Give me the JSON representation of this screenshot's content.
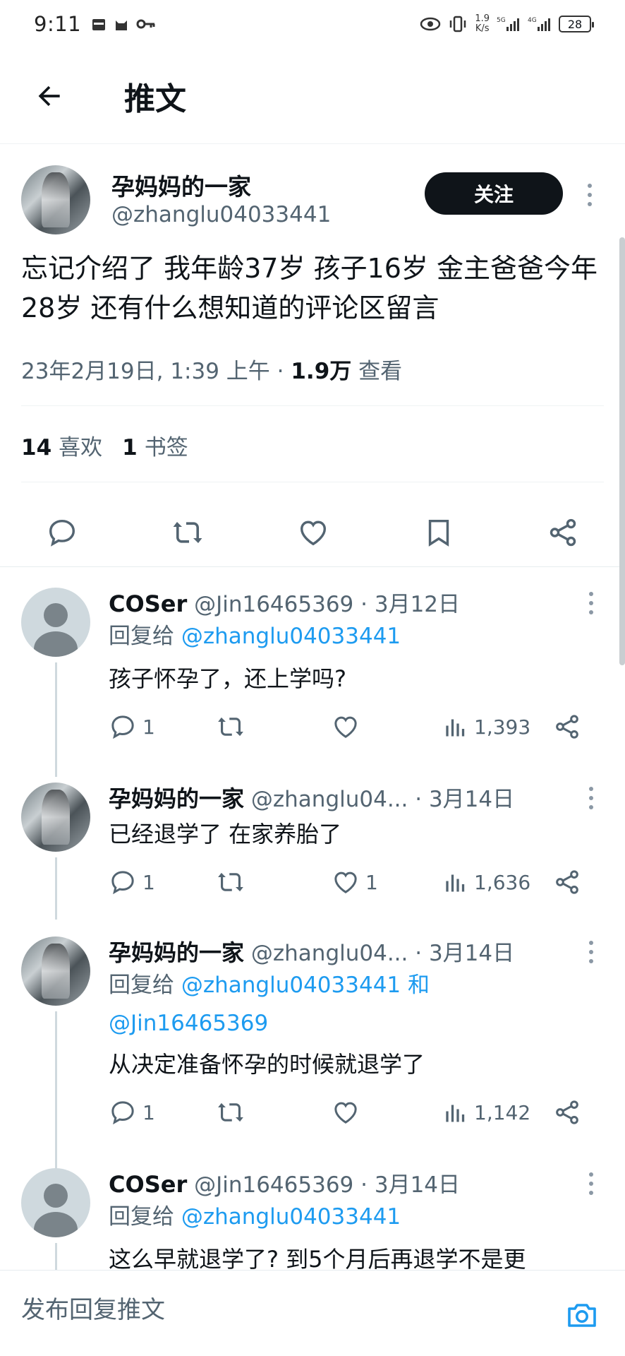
{
  "status_bar": {
    "time": "9:11",
    "net_speed_value": "1.9",
    "net_speed_unit": "K/s",
    "battery": "28"
  },
  "header": {
    "title": "推文"
  },
  "main_tweet": {
    "author_name": "孕妈妈的一家",
    "author_handle": "@zhanglu04033441",
    "follow_label": "关注",
    "text": "忘记介绍了 我年龄37岁 孩子16岁 金主爸爸今年28岁  还有什么想知道的评论区留言",
    "date": "23年2月19日, 1:39 上午 · ",
    "views_count": "1.9万",
    "views_label": " 查看",
    "likes_count": "14",
    "likes_label": "喜欢",
    "bookmarks_count": "1",
    "bookmarks_label": "书签"
  },
  "replies": [
    {
      "name": "COSer",
      "handle": "@Jin16465369",
      "date": " · 3月12日",
      "reply_to_prefix": "回复给 ",
      "reply_to": "@zhanglu04033441",
      "text": "孩子怀孕了，还上学吗?",
      "reply_count": "1",
      "like_count": "",
      "view_count": "1,393"
    },
    {
      "name": "孕妈妈的一家",
      "handle": "@zhanglu04...",
      "date": " · 3月14日",
      "text": "已经退学了 在家养胎了",
      "reply_count": "1",
      "like_count": "1",
      "view_count": "1,636"
    },
    {
      "name": "孕妈妈的一家",
      "handle": "@zhanglu04...",
      "date": " · 3月14日",
      "reply_to_prefix": "回复给 ",
      "reply_to": "@zhanglu04033441 和",
      "reply_to_2": "@Jin16465369",
      "text": "从决定准备怀孕的时候就退学了",
      "reply_count": "1",
      "like_count": "",
      "view_count": "1,142"
    },
    {
      "name": "COSer",
      "handle": "@Jin16465369",
      "date": " · 3月14日",
      "reply_to_prefix": "回复给 ",
      "reply_to": "@zhanglu04033441",
      "text": "这么早就退学了? 到5个月后再退学不是更"
    }
  ],
  "compose": {
    "placeholder": "发布回复推文"
  },
  "icons": {
    "back": "arrow-left-icon",
    "more": "more-vertical-icon",
    "reply": "comment-bubble-icon",
    "retweet": "retweet-icon",
    "like": "heart-icon",
    "bookmark": "bookmark-icon",
    "share": "share-icon",
    "views": "bar-chart-icon",
    "camera": "camera-icon"
  },
  "colors": {
    "text_primary": "#0f1419",
    "text_secondary": "#536471",
    "mention": "#1d9bf0",
    "follow_button_bg": "#0f1419",
    "camera_accent": "#1d9bf0"
  }
}
